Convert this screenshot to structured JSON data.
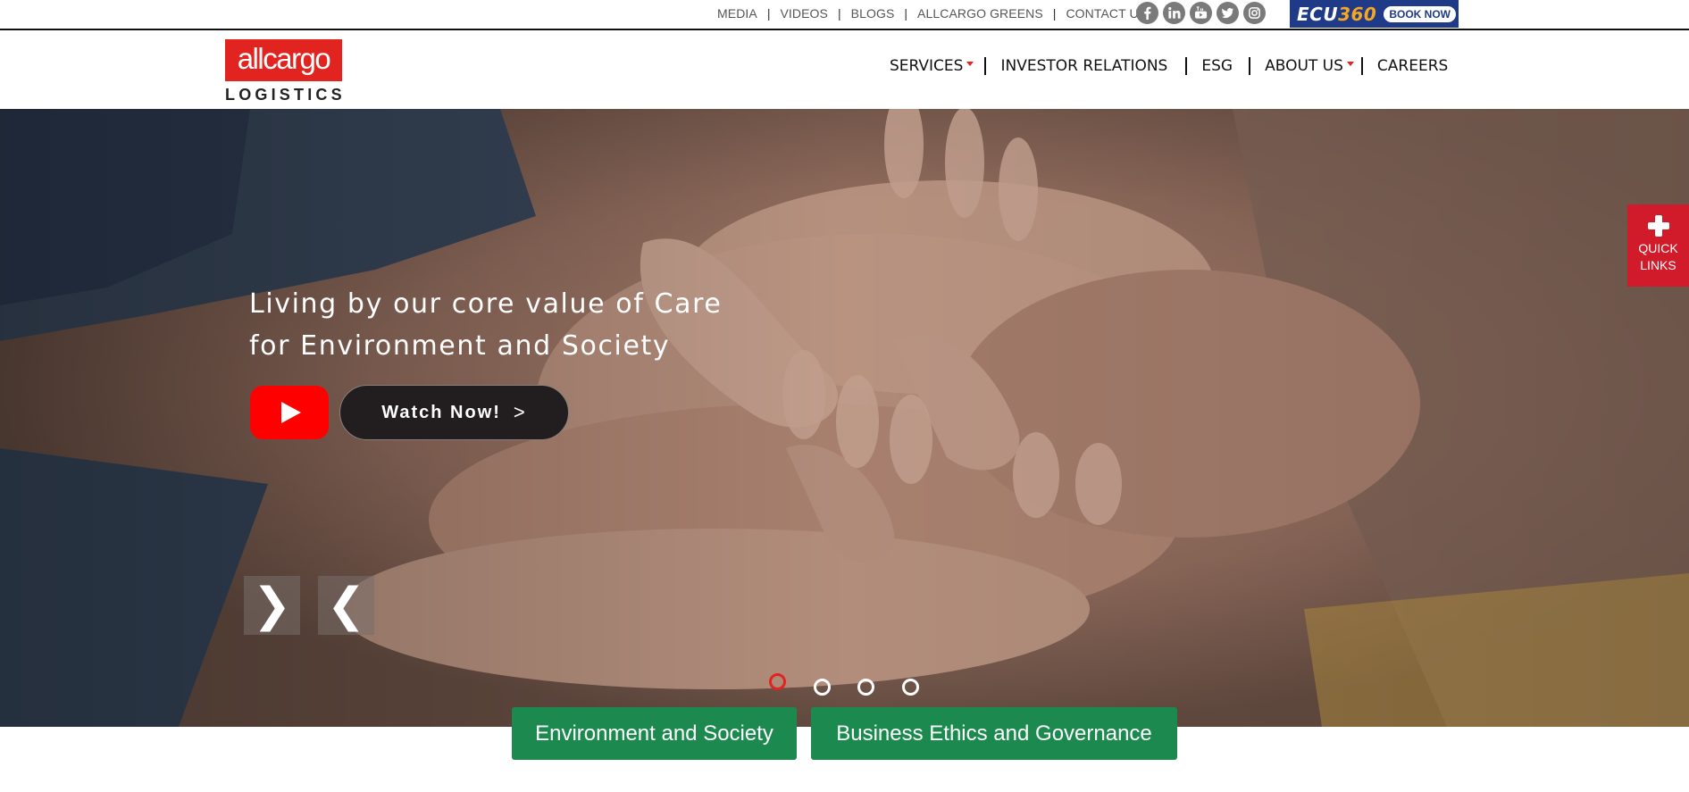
{
  "topbar": {
    "links": [
      "MEDIA",
      "VIDEOS",
      "BLOGS",
      "ALLCARGO GREENS",
      "CONTACT US"
    ],
    "social_icons": [
      "facebook-icon",
      "linkedin-icon",
      "youtube-icon",
      "twitter-icon",
      "instagram-icon"
    ],
    "ecu360": {
      "logo_prefix": "ECU",
      "logo_suffix": "360",
      "book_label": "BOOK NOW"
    }
  },
  "header": {
    "logo_main": "allcargo",
    "logo_sub": "LOGISTICS",
    "nav": [
      {
        "label": "SERVICES",
        "dropdown": true
      },
      {
        "label": "INVESTOR RELATIONS",
        "dropdown": false
      },
      {
        "label": "ESG",
        "dropdown": false
      },
      {
        "label": "ABOUT US",
        "dropdown": true
      },
      {
        "label": "CAREERS",
        "dropdown": false
      }
    ]
  },
  "hero": {
    "headline_line1": "Living by our core value of Care",
    "headline_line2": "for Environment and Society",
    "watch_label": "Watch Now!",
    "watch_chevron": ">",
    "next_arrow": "❯",
    "prev_arrow": "❮",
    "slide_count": 4,
    "active_slide": 1
  },
  "quick_links": {
    "line1": "QUICK",
    "line2": "LINKS"
  },
  "tabs": [
    "Environment and Society",
    "Business Ethics and Governance"
  ],
  "colors": {
    "brand_red": "#e1241f",
    "quick_links_red": "#d11b2a",
    "tab_green": "#1c8a4f",
    "ecu_blue": "#1f3a86",
    "youtube_red": "#ff0000"
  }
}
